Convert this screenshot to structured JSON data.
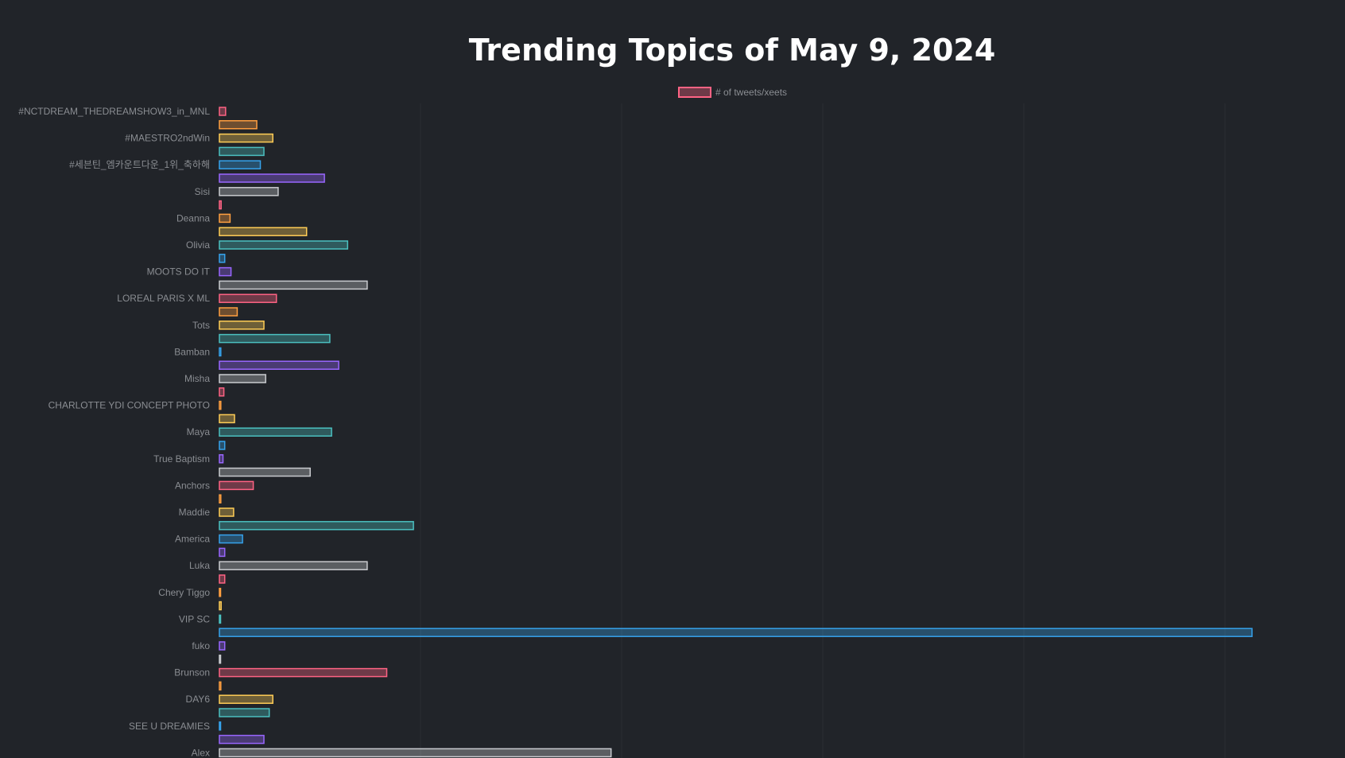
{
  "chart_data": {
    "type": "bar",
    "orientation": "horizontal",
    "title": "Trending Topics of May 9, 2024",
    "legend": {
      "label": "# of tweets/xeets",
      "position": "top"
    },
    "grid": true,
    "xlim": [
      0,
      58
    ],
    "series": [
      {
        "name": "# of tweets/xeets",
        "categories": [
          "#NCTDREAM_THEDREAMSHOW3_in_MNL",
          "",
          "#MAESTRO2ndWin",
          "",
          "#세븐틴_엠카운트다운_1위_축하해",
          "",
          "Sisi",
          "",
          "Deanna",
          "",
          "Olivia",
          "",
          "MOOTS DO IT",
          "",
          "LOREAL PARIS X ML",
          "",
          "Tots",
          "",
          "Bamban",
          "",
          "Misha",
          "",
          "CHARLOTTE YDI CONCEPT PHOTO",
          "",
          "Maya",
          "",
          "True Baptism",
          "",
          "Anchors",
          "",
          "Maddie",
          "",
          "America",
          "",
          "Luka",
          "",
          "Chery Tiggo",
          "",
          "VIP SC",
          "",
          "fuko",
          "",
          "Brunson",
          "",
          "DAY6",
          "",
          "SEE U DREAMIES",
          "",
          "Alex"
        ],
        "values": [
          0.35,
          2.1,
          3.0,
          2.5,
          2.3,
          5.9,
          3.3,
          0.1,
          0.6,
          4.9,
          7.2,
          0.3,
          0.65,
          8.3,
          3.2,
          1.0,
          2.5,
          6.2,
          0.08,
          6.7,
          2.6,
          0.25,
          0.08,
          0.85,
          6.3,
          0.3,
          0.2,
          5.1,
          1.9,
          0.08,
          0.8,
          10.9,
          1.3,
          0.3,
          8.3,
          0.3,
          0.05,
          0.1,
          0.05,
          58.0,
          0.3,
          0.06,
          9.4,
          0.08,
          3.0,
          2.8,
          0.06,
          2.5,
          22.0
        ]
      }
    ],
    "colors": {
      "background": "#212429",
      "title": "#ffffff",
      "text": "#8a8d92",
      "grid": "#2b2e33",
      "cycle": [
        {
          "stroke": "#ff6384",
          "fill": "rgba(255,99,132,0.35)"
        },
        {
          "stroke": "#ff9f40",
          "fill": "rgba(255,159,64,0.35)"
        },
        {
          "stroke": "#ffcd56",
          "fill": "rgba(255,205,86,0.35)"
        },
        {
          "stroke": "#4bc0c0",
          "fill": "rgba(75,192,192,0.35)"
        },
        {
          "stroke": "#36a2eb",
          "fill": "rgba(54,162,235,0.35)"
        },
        {
          "stroke": "#9966ff",
          "fill": "rgba(153,102,255,0.35)"
        },
        {
          "stroke": "#c9cbcf",
          "fill": "rgba(201,203,207,0.35)"
        }
      ]
    }
  }
}
